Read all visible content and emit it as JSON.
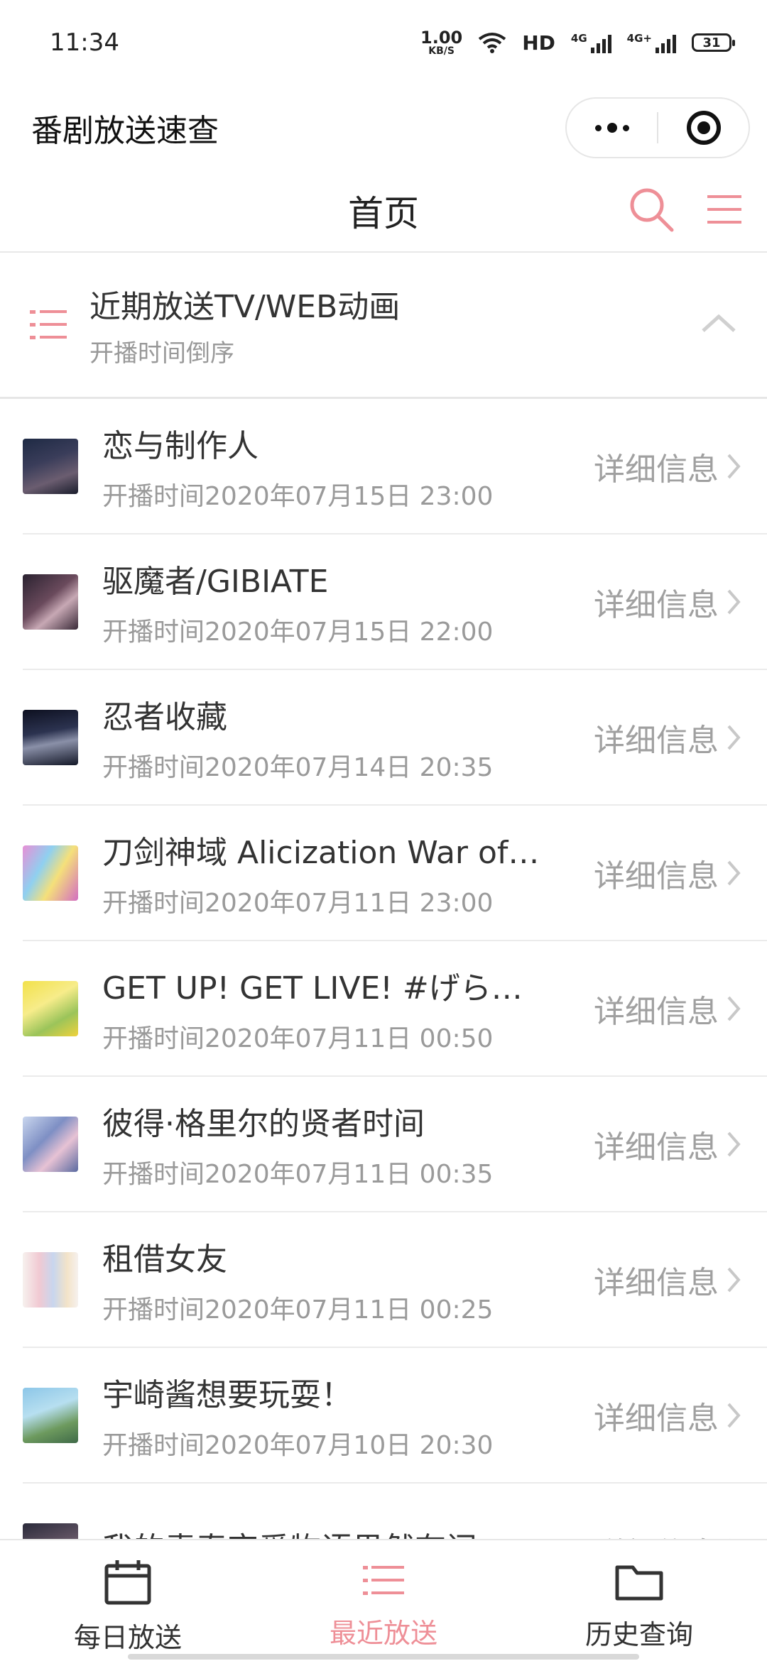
{
  "status_bar": {
    "time": "11:34",
    "net_speed_value": "1.00",
    "net_speed_unit": "KB/S",
    "hd_label": "HD",
    "signal1_label": "4G",
    "signal2_label": "4G+",
    "battery": "31"
  },
  "header": {
    "title": "番剧放送速查"
  },
  "nav": {
    "title": "首页"
  },
  "section": {
    "title": "近期放送TV/WEB动画",
    "subtitle": "开播时间倒序"
  },
  "detail_label": "详细信息",
  "items": [
    {
      "title": "恋与制作人",
      "time": "开播时间2020年07月15日 23:00"
    },
    {
      "title": "驱魔者/GIBIATE",
      "time": "开播时间2020年07月15日 22:00"
    },
    {
      "title": "忍者收藏",
      "time": "开播时间2020年07月14日 20:35"
    },
    {
      "title": "刀剑神域 Alicization War of …",
      "time": "开播时间2020年07月11日 23:00"
    },
    {
      "title": "GET UP! GET LIVE! #げらげら",
      "time": "开播时间2020年07月11日 00:50"
    },
    {
      "title": "彼得·格里尔的贤者时间",
      "time": "开播时间2020年07月11日 00:35"
    },
    {
      "title": "租借女友",
      "time": "开播时间2020年07月11日 00:25"
    },
    {
      "title": "宇崎酱想要玩耍！",
      "time": "开播时间2020年07月10日 20:30"
    },
    {
      "title": "我的青春恋爱物语果然有问…",
      "time": ""
    }
  ],
  "tabs": [
    {
      "label": "每日放送",
      "active": false
    },
    {
      "label": "最近放送",
      "active": true
    },
    {
      "label": "历史查询",
      "active": false
    }
  ],
  "colors": {
    "accent": "#ee8f97",
    "text": "#333333",
    "muted": "#9a9a9a",
    "divider": "#ebebeb"
  }
}
